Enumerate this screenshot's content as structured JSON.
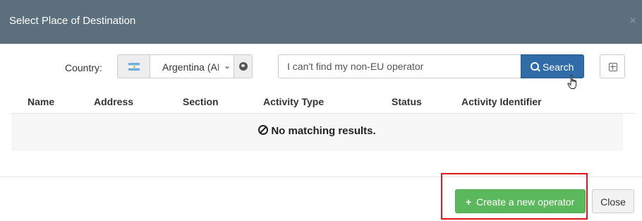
{
  "dialog": {
    "title": "Select Place of Destination",
    "close_glyph": "×"
  },
  "filters": {
    "country_label": "Country:",
    "country_flag_icon": "argentina-flag-icon",
    "country_value": "Argentina (AI",
    "globe_icon": "globe-icon",
    "search_placeholder": "I can't find my non-EU operator",
    "search_button_label": "Search",
    "expand_icon": "plus-square-icon"
  },
  "table": {
    "columns": [
      "Name",
      "Address",
      "Section",
      "Activity Type",
      "Status",
      "Activity Identifier"
    ],
    "empty_message": "No matching results."
  },
  "footer": {
    "create_button_label": "Create a new operator",
    "close_button_label": "Close"
  },
  "colors": {
    "header_bg": "#5b6f7d",
    "primary": "#2f6ca8",
    "success": "#5cb85c",
    "highlight_border": "#e2171c"
  }
}
